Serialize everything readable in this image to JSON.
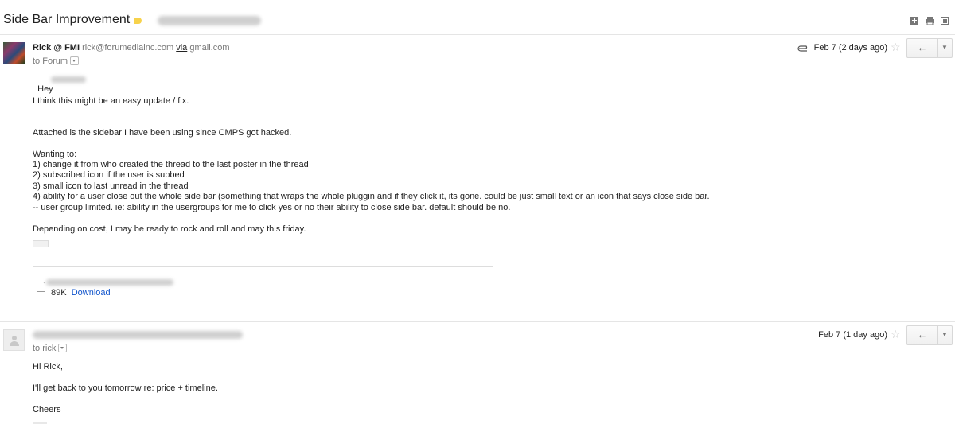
{
  "thread": {
    "subject": "Side Bar Improvement"
  },
  "messages": [
    {
      "sender_name": "Rick @ FMI",
      "sender_email": "rick@forumediainc.com",
      "via_label": "via",
      "via_domain": "gmail.com",
      "to_line": "to Forum",
      "date": "Feb 7 (2 days ago)",
      "body": {
        "greeting": "Hey",
        "line1": "I think this might be an easy update / fix.",
        "line2": "Attached is the sidebar I have been using since CMPS got hacked.",
        "wanting_heading": "Wanting to:",
        "item1": "1) change it from who created the thread to the last poster in the thread",
        "item2": "2) subscribed icon if the user is subbed",
        "item3": "3) small icon to last unread in the thread",
        "item4": "4) ability for a user close out the whole side bar (something that wraps the whole pluggin and if they click it, its gone. could be just small text or an icon that says close side bar.",
        "item5": "-- user group limited. ie: ability in the usergroups for me to click yes or no their ability to close side bar. default should be no.",
        "closing": "Depending on cost, I may be ready to rock and roll and may this friday.",
        "ellipsis": "..."
      },
      "attachment": {
        "size": "89K",
        "download_label": "Download"
      }
    },
    {
      "to_line": "to rick",
      "date": "Feb 7 (1 day ago)",
      "body": {
        "greeting": "Hi Rick,",
        "line1": "I'll get back to you tomorrow re: price + timeline.",
        "signoff": "Cheers"
      }
    }
  ],
  "icons": {
    "star": "☆",
    "reply": "←",
    "more": "▼",
    "paperclip": "paperclip-icon"
  },
  "colors": {
    "link": "#1155cc",
    "label": "#f7d24b"
  }
}
